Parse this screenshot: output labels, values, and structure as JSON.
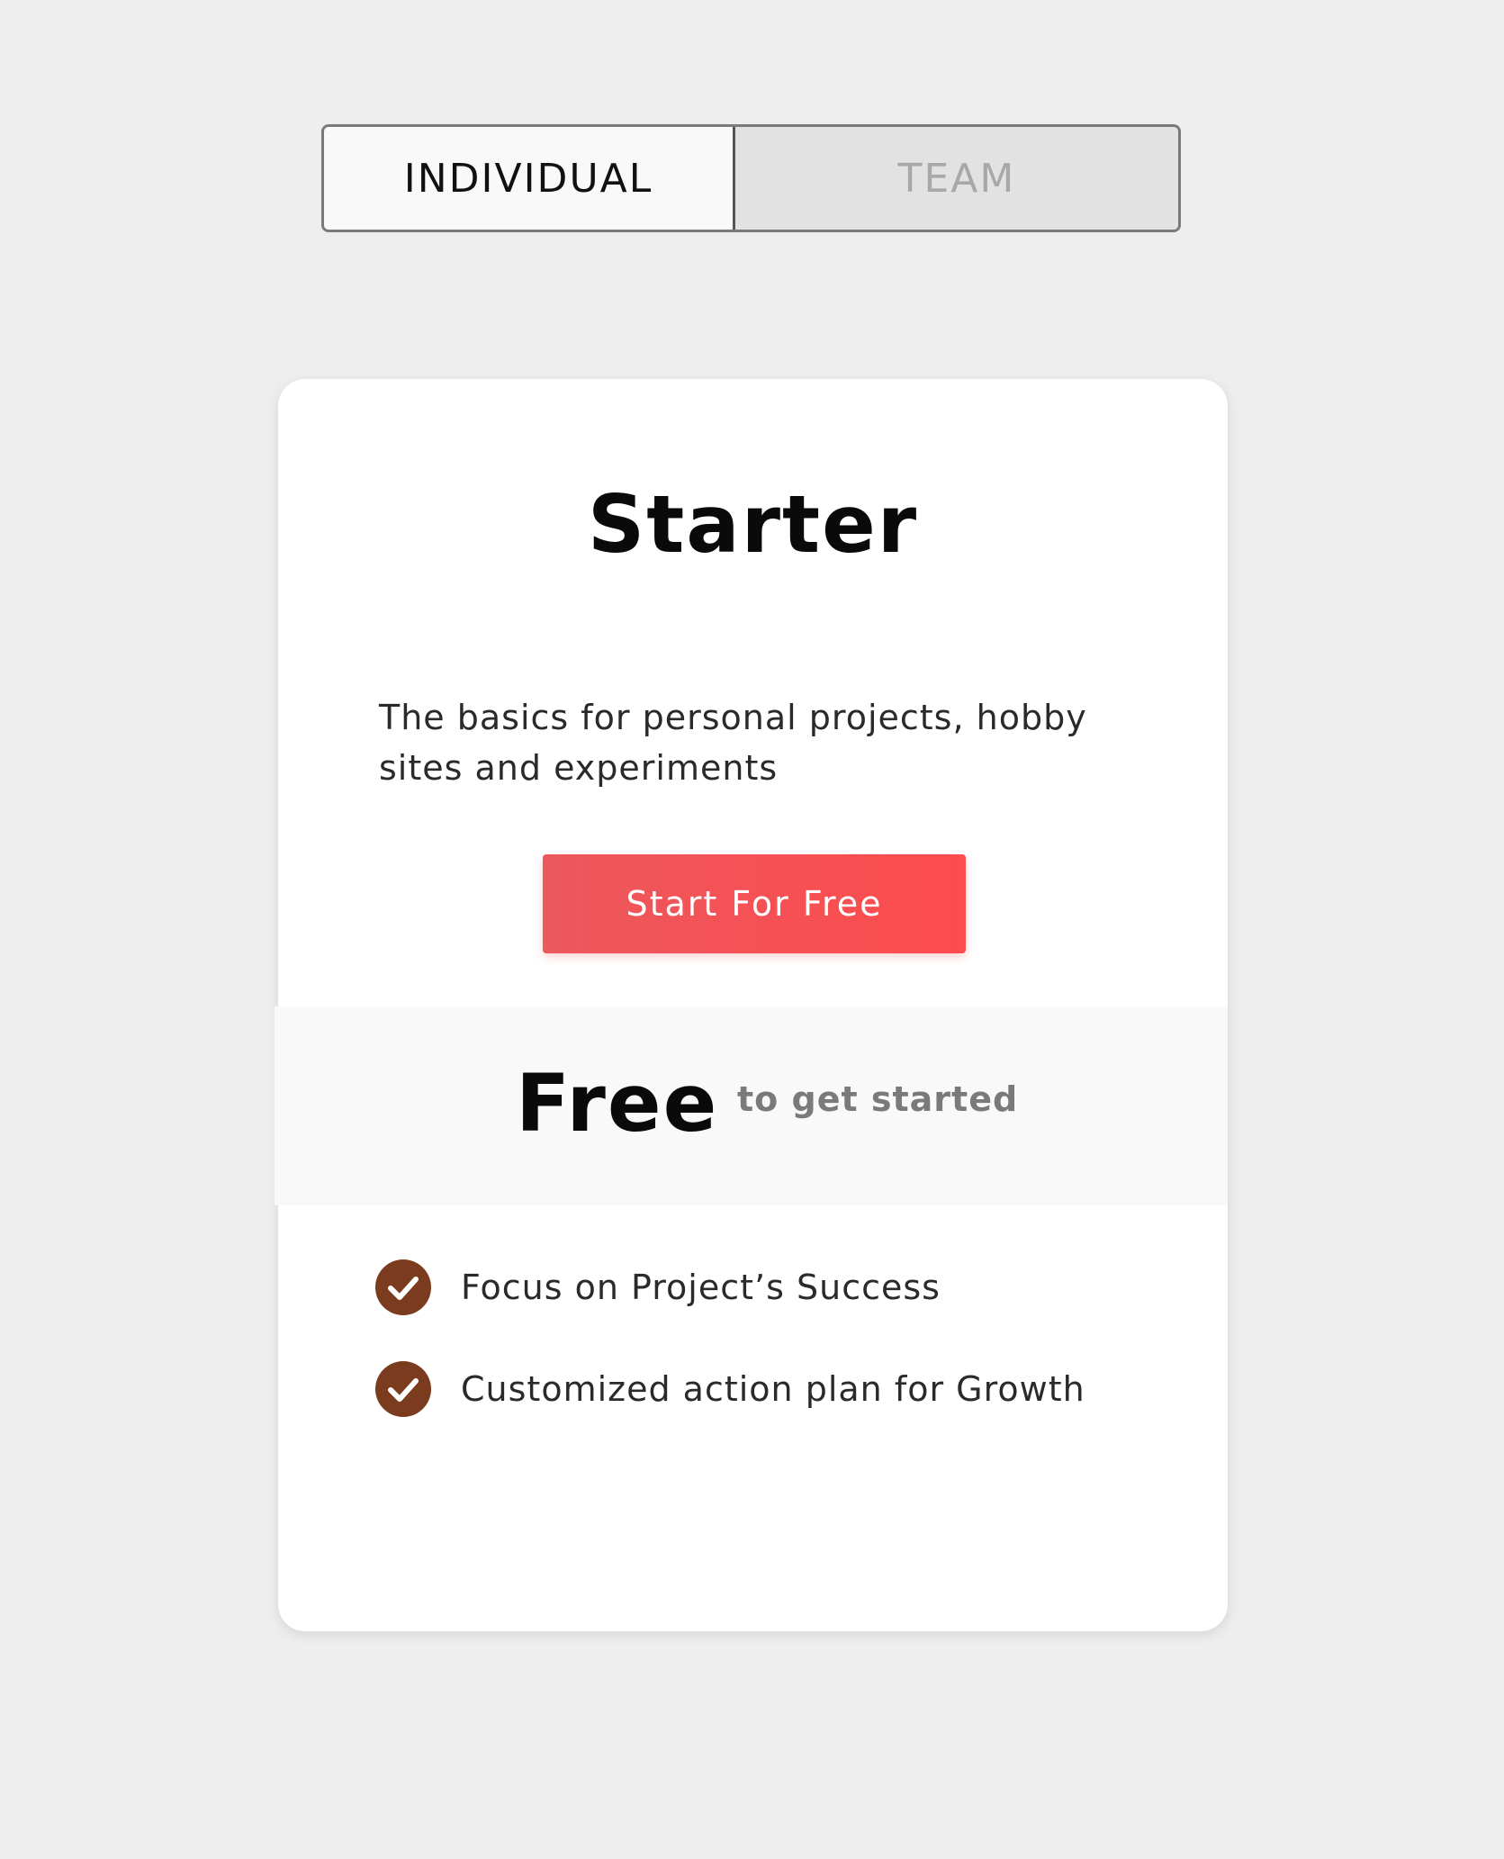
{
  "toggle": {
    "options": [
      {
        "label": "INDIVIDUAL",
        "selected": true
      },
      {
        "label": "TEAM",
        "selected": false
      }
    ]
  },
  "plan": {
    "title": "Starter",
    "description": "The basics for personal projects, hobby sites and experiments",
    "cta_label": "Start For Free",
    "price": "Free",
    "price_note": "to get started",
    "features": [
      {
        "text": "Focus on Project’s Success",
        "icon": "check-circle-icon"
      },
      {
        "text": "Customized action plan for Growth",
        "icon": "check-circle-icon"
      }
    ]
  },
  "colors": {
    "page_background": "#eeeeee",
    "cta_start": "#ec585c",
    "cta_end": "#fd4b4e",
    "check_icon": "#7a3b1e",
    "price_band": "#f9f9f9"
  }
}
